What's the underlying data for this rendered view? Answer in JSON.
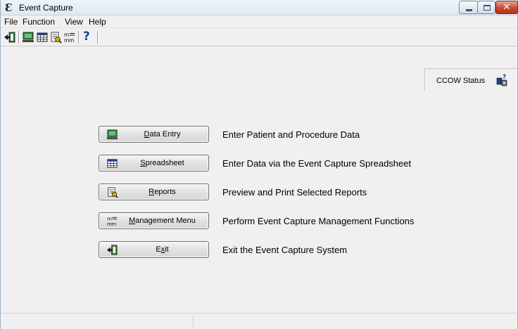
{
  "window": {
    "title": "Event Capture",
    "app_icon_glyph": "Ɛ"
  },
  "menu": {
    "items": [
      {
        "label": "File"
      },
      {
        "label": "Function"
      },
      {
        "label": "View"
      },
      {
        "label": "Help"
      }
    ]
  },
  "toolbar": {
    "icons": [
      "exit-door-icon",
      "data-entry-icon",
      "spreadsheet-icon",
      "reports-icon",
      "management-menu-icon",
      "help-icon"
    ],
    "help_glyph": "?"
  },
  "ccow": {
    "label": "CCOW Status",
    "icon": "ccow-status-icon"
  },
  "actions": [
    {
      "label": "Data Entry",
      "accel": "D",
      "rest": "ata Entry",
      "pre": "",
      "description": "Enter Patient and Procedure Data",
      "icon": "data-entry-icon"
    },
    {
      "label": "Spreadsheet",
      "accel": "S",
      "rest": "preadsheet",
      "pre": "",
      "description": "Enter Data via the Event Capture Spreadsheet",
      "icon": "spreadsheet-icon"
    },
    {
      "label": "Reports",
      "accel": "R",
      "rest": "eports",
      "pre": "",
      "description": "Preview and Print Selected Reports",
      "icon": "reports-icon"
    },
    {
      "label": "Management Menu",
      "accel": "M",
      "rest": "anagement Menu",
      "pre": "",
      "description": "Perform Event Capture Management Functions",
      "icon": "management-menu-icon"
    },
    {
      "label": "Exit",
      "accel": "x",
      "rest": "it",
      "pre": "E",
      "description": "Exit the Event Capture System",
      "icon": "exit-door-icon"
    }
  ],
  "colors": {
    "background": "#f0f0f0",
    "close_button": "#c74a34"
  }
}
